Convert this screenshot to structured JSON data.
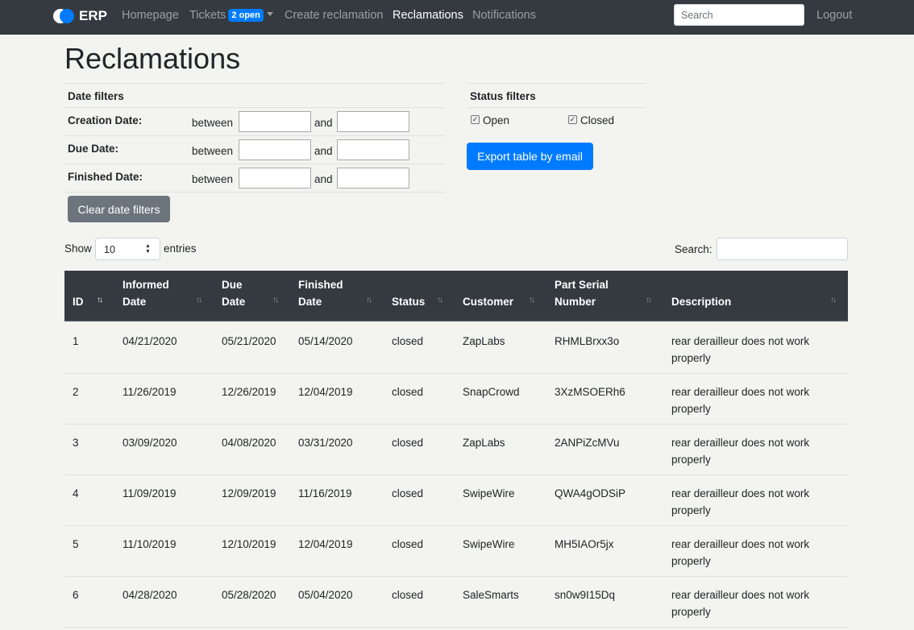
{
  "navbar": {
    "brand": "ERP",
    "links": {
      "homepage": "Homepage",
      "tickets": "Tickets",
      "tickets_badge": "2 open",
      "create": "Create reclamation",
      "reclamations": "Reclamations",
      "notifications": "Notifications"
    },
    "search_placeholder": "Search",
    "logout": "Logout"
  },
  "page_title": "Reclamations",
  "date_filters": {
    "heading": "Date filters",
    "rows": [
      {
        "label": "Creation Date:",
        "between": "between",
        "and": "and"
      },
      {
        "label": "Due Date:",
        "between": "between",
        "and": "and"
      },
      {
        "label": "Finished Date:",
        "between": "between",
        "and": "and"
      }
    ],
    "clear_button": "Clear date filters"
  },
  "status_filters": {
    "heading": "Status filters",
    "open": "Open",
    "closed": "Closed",
    "open_checked": true,
    "closed_checked": true
  },
  "export_button": "Export table by email",
  "table_controls": {
    "show": "Show",
    "entries_value": "10",
    "entries": "entries",
    "search_label": "Search:"
  },
  "table": {
    "headers": {
      "id": "ID",
      "informed_1": "Informed",
      "informed_2": "Date",
      "due_1": "Due",
      "due_2": "Date",
      "finished_1": "Finished",
      "finished_2": "Date",
      "status": "Status",
      "customer": "Customer",
      "serial_1": "Part Serial",
      "serial_2": "Number",
      "description": "Description"
    },
    "rows": [
      {
        "id": "1",
        "informed": "04/21/2020",
        "due": "05/21/2020",
        "finished": "05/14/2020",
        "status": "closed",
        "customer": "ZapLabs",
        "serial": "RHMLBrxx3o",
        "desc1": "rear derailleur does not work",
        "desc2": "properly"
      },
      {
        "id": "2",
        "informed": "11/26/2019",
        "due": "12/26/2019",
        "finished": "12/04/2019",
        "status": "closed",
        "customer": "SnapCrowd",
        "serial": "3XzMSOERh6",
        "desc1": "rear derailleur does not work",
        "desc2": "properly"
      },
      {
        "id": "3",
        "informed": "03/09/2020",
        "due": "04/08/2020",
        "finished": "03/31/2020",
        "status": "closed",
        "customer": "ZapLabs",
        "serial": "2ANPiZcMVu",
        "desc1": "rear derailleur does not work",
        "desc2": "properly"
      },
      {
        "id": "4",
        "informed": "11/09/2019",
        "due": "12/09/2019",
        "finished": "11/16/2019",
        "status": "closed",
        "customer": "SwipeWire",
        "serial": "QWA4gODSiP",
        "desc1": "rear derailleur does not work",
        "desc2": "properly"
      },
      {
        "id": "5",
        "informed": "11/10/2019",
        "due": "12/10/2019",
        "finished": "12/04/2019",
        "status": "closed",
        "customer": "SwipeWire",
        "serial": "MH5IAOr5jx",
        "desc1": "rear derailleur does not work",
        "desc2": "properly"
      },
      {
        "id": "6",
        "informed": "04/28/2020",
        "due": "05/28/2020",
        "finished": "05/04/2020",
        "status": "closed",
        "customer": "SaleSmarts",
        "serial": "sn0w9I15Dq",
        "desc1": "rear derailleur does not work",
        "desc2": "properly"
      }
    ]
  }
}
